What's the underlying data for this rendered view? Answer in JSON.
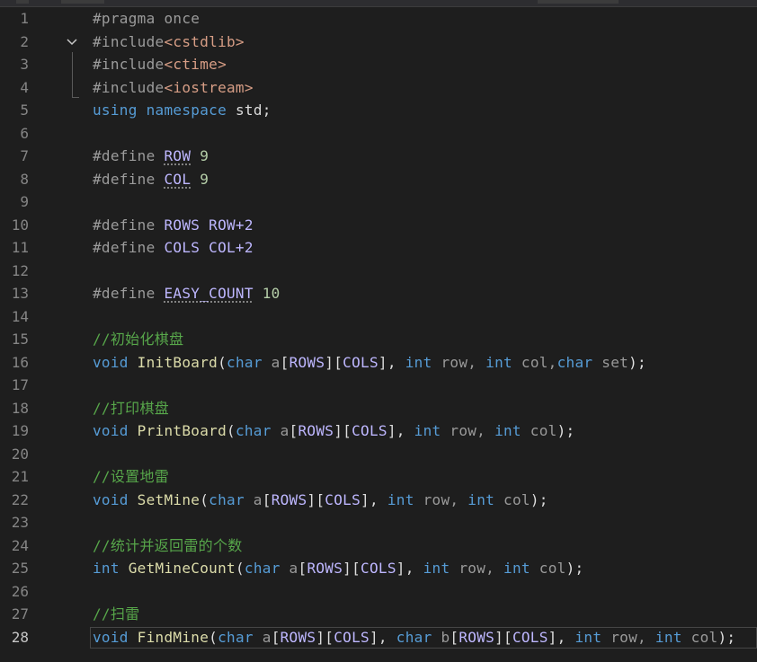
{
  "editor": {
    "current_line": 28,
    "colors": {
      "background": "#1e1e1e",
      "keyword": "#569cd6",
      "function": "#dcdcaa",
      "string": "#d69d85",
      "macro": "#beb7ff",
      "number": "#b5cea8",
      "comment": "#57a64a",
      "line_number": "#858585"
    },
    "fold_icon": "chevron-down-icon",
    "lines": [
      {
        "n": "1",
        "tokens": [
          {
            "t": "#pragma once",
            "c": "pre"
          }
        ]
      },
      {
        "n": "2",
        "tokens": [
          {
            "t": "#include",
            "c": "pre"
          },
          {
            "t": "<cstdlib>",
            "c": "str"
          }
        ]
      },
      {
        "n": "3",
        "tokens": [
          {
            "t": "#include",
            "c": "pre"
          },
          {
            "t": "<ctime>",
            "c": "str"
          }
        ]
      },
      {
        "n": "4",
        "tokens": [
          {
            "t": "#include",
            "c": "pre"
          },
          {
            "t": "<iostream>",
            "c": "str"
          }
        ]
      },
      {
        "n": "5",
        "tokens": [
          {
            "t": "using",
            "c": "kw"
          },
          {
            "t": " ",
            "c": "id"
          },
          {
            "t": "namespace",
            "c": "kw"
          },
          {
            "t": " std;",
            "c": "id"
          }
        ]
      },
      {
        "n": "6",
        "tokens": []
      },
      {
        "n": "7",
        "tokens": [
          {
            "t": "#define ",
            "c": "pre"
          },
          {
            "t": "ROW",
            "c": "macro",
            "sq": true
          },
          {
            "t": " 9",
            "c": "num"
          }
        ]
      },
      {
        "n": "8",
        "tokens": [
          {
            "t": "#define ",
            "c": "pre"
          },
          {
            "t": "COL",
            "c": "macro",
            "sq": true
          },
          {
            "t": " 9",
            "c": "num"
          }
        ]
      },
      {
        "n": "9",
        "tokens": []
      },
      {
        "n": "10",
        "tokens": [
          {
            "t": "#define ",
            "c": "pre"
          },
          {
            "t": "ROWS",
            "c": "macro"
          },
          {
            "t": " ROW+2",
            "c": "macro"
          }
        ]
      },
      {
        "n": "11",
        "tokens": [
          {
            "t": "#define ",
            "c": "pre"
          },
          {
            "t": "COLS",
            "c": "macro"
          },
          {
            "t": " COL+2",
            "c": "macro"
          }
        ]
      },
      {
        "n": "12",
        "tokens": []
      },
      {
        "n": "13",
        "tokens": [
          {
            "t": "#define ",
            "c": "pre"
          },
          {
            "t": "EASY_COUNT",
            "c": "macro",
            "sq": true
          },
          {
            "t": " 10",
            "c": "num"
          }
        ]
      },
      {
        "n": "14",
        "tokens": []
      },
      {
        "n": "15",
        "tokens": [
          {
            "t": "//初始化棋盘",
            "c": "cm"
          }
        ]
      },
      {
        "n": "16",
        "tokens": [
          {
            "t": "void",
            "c": "kw"
          },
          {
            "t": " ",
            "c": "id"
          },
          {
            "t": "InitBoard",
            "c": "fn"
          },
          {
            "t": "(",
            "c": "punct"
          },
          {
            "t": "char",
            "c": "kw"
          },
          {
            "t": " a",
            "c": "param"
          },
          {
            "t": "[",
            "c": "punct"
          },
          {
            "t": "ROWS",
            "c": "macro"
          },
          {
            "t": "][",
            "c": "punct"
          },
          {
            "t": "COLS",
            "c": "macro"
          },
          {
            "t": "], ",
            "c": "punct"
          },
          {
            "t": "int",
            "c": "kw"
          },
          {
            "t": " row, ",
            "c": "param"
          },
          {
            "t": "int",
            "c": "kw"
          },
          {
            "t": " col,",
            "c": "param"
          },
          {
            "t": "char",
            "c": "kw"
          },
          {
            "t": " set",
            "c": "param"
          },
          {
            "t": ");",
            "c": "punct"
          }
        ]
      },
      {
        "n": "17",
        "tokens": []
      },
      {
        "n": "18",
        "tokens": [
          {
            "t": "//打印棋盘",
            "c": "cm"
          }
        ]
      },
      {
        "n": "19",
        "tokens": [
          {
            "t": "void",
            "c": "kw"
          },
          {
            "t": " ",
            "c": "id"
          },
          {
            "t": "PrintBoard",
            "c": "fn"
          },
          {
            "t": "(",
            "c": "punct"
          },
          {
            "t": "char",
            "c": "kw"
          },
          {
            "t": " a",
            "c": "param"
          },
          {
            "t": "[",
            "c": "punct"
          },
          {
            "t": "ROWS",
            "c": "macro"
          },
          {
            "t": "][",
            "c": "punct"
          },
          {
            "t": "COLS",
            "c": "macro"
          },
          {
            "t": "], ",
            "c": "punct"
          },
          {
            "t": "int",
            "c": "kw"
          },
          {
            "t": " row, ",
            "c": "param"
          },
          {
            "t": "int",
            "c": "kw"
          },
          {
            "t": " col",
            "c": "param"
          },
          {
            "t": ");",
            "c": "punct"
          }
        ]
      },
      {
        "n": "20",
        "tokens": []
      },
      {
        "n": "21",
        "tokens": [
          {
            "t": "//设置地雷",
            "c": "cm"
          }
        ]
      },
      {
        "n": "22",
        "tokens": [
          {
            "t": "void",
            "c": "kw"
          },
          {
            "t": " ",
            "c": "id"
          },
          {
            "t": "SetMine",
            "c": "fn"
          },
          {
            "t": "(",
            "c": "punct"
          },
          {
            "t": "char",
            "c": "kw"
          },
          {
            "t": " a",
            "c": "param"
          },
          {
            "t": "[",
            "c": "punct"
          },
          {
            "t": "ROWS",
            "c": "macro"
          },
          {
            "t": "][",
            "c": "punct"
          },
          {
            "t": "COLS",
            "c": "macro"
          },
          {
            "t": "], ",
            "c": "punct"
          },
          {
            "t": "int",
            "c": "kw"
          },
          {
            "t": " row, ",
            "c": "param"
          },
          {
            "t": "int",
            "c": "kw"
          },
          {
            "t": " col",
            "c": "param"
          },
          {
            "t": ");",
            "c": "punct"
          }
        ]
      },
      {
        "n": "23",
        "tokens": []
      },
      {
        "n": "24",
        "tokens": [
          {
            "t": "//统计并返回雷的个数",
            "c": "cm"
          }
        ]
      },
      {
        "n": "25",
        "tokens": [
          {
            "t": "int",
            "c": "kw"
          },
          {
            "t": " ",
            "c": "id"
          },
          {
            "t": "GetMineCount",
            "c": "fn"
          },
          {
            "t": "(",
            "c": "punct"
          },
          {
            "t": "char",
            "c": "kw"
          },
          {
            "t": " a",
            "c": "param"
          },
          {
            "t": "[",
            "c": "punct"
          },
          {
            "t": "ROWS",
            "c": "macro"
          },
          {
            "t": "][",
            "c": "punct"
          },
          {
            "t": "COLS",
            "c": "macro"
          },
          {
            "t": "], ",
            "c": "punct"
          },
          {
            "t": "int",
            "c": "kw"
          },
          {
            "t": " row, ",
            "c": "param"
          },
          {
            "t": "int",
            "c": "kw"
          },
          {
            "t": " col",
            "c": "param"
          },
          {
            "t": ");",
            "c": "punct"
          }
        ]
      },
      {
        "n": "26",
        "tokens": []
      },
      {
        "n": "27",
        "tokens": [
          {
            "t": "//扫雷",
            "c": "cm"
          }
        ]
      },
      {
        "n": "28",
        "tokens": [
          {
            "t": "void",
            "c": "kw"
          },
          {
            "t": " ",
            "c": "id"
          },
          {
            "t": "FindMine",
            "c": "fn"
          },
          {
            "t": "(",
            "c": "punct"
          },
          {
            "t": "char",
            "c": "kw"
          },
          {
            "t": " a",
            "c": "param"
          },
          {
            "t": "[",
            "c": "punct"
          },
          {
            "t": "ROWS",
            "c": "macro"
          },
          {
            "t": "][",
            "c": "punct"
          },
          {
            "t": "COLS",
            "c": "macro"
          },
          {
            "t": "], ",
            "c": "punct"
          },
          {
            "t": "char",
            "c": "kw"
          },
          {
            "t": " b",
            "c": "param"
          },
          {
            "t": "[",
            "c": "punct"
          },
          {
            "t": "ROWS",
            "c": "macro"
          },
          {
            "t": "][",
            "c": "punct"
          },
          {
            "t": "COLS",
            "c": "macro"
          },
          {
            "t": "], ",
            "c": "punct"
          },
          {
            "t": "int",
            "c": "kw"
          },
          {
            "t": " row, ",
            "c": "param"
          },
          {
            "t": "int",
            "c": "kw"
          },
          {
            "t": " col",
            "c": "param"
          },
          {
            "t": ");",
            "c": "punct"
          }
        ]
      }
    ]
  }
}
